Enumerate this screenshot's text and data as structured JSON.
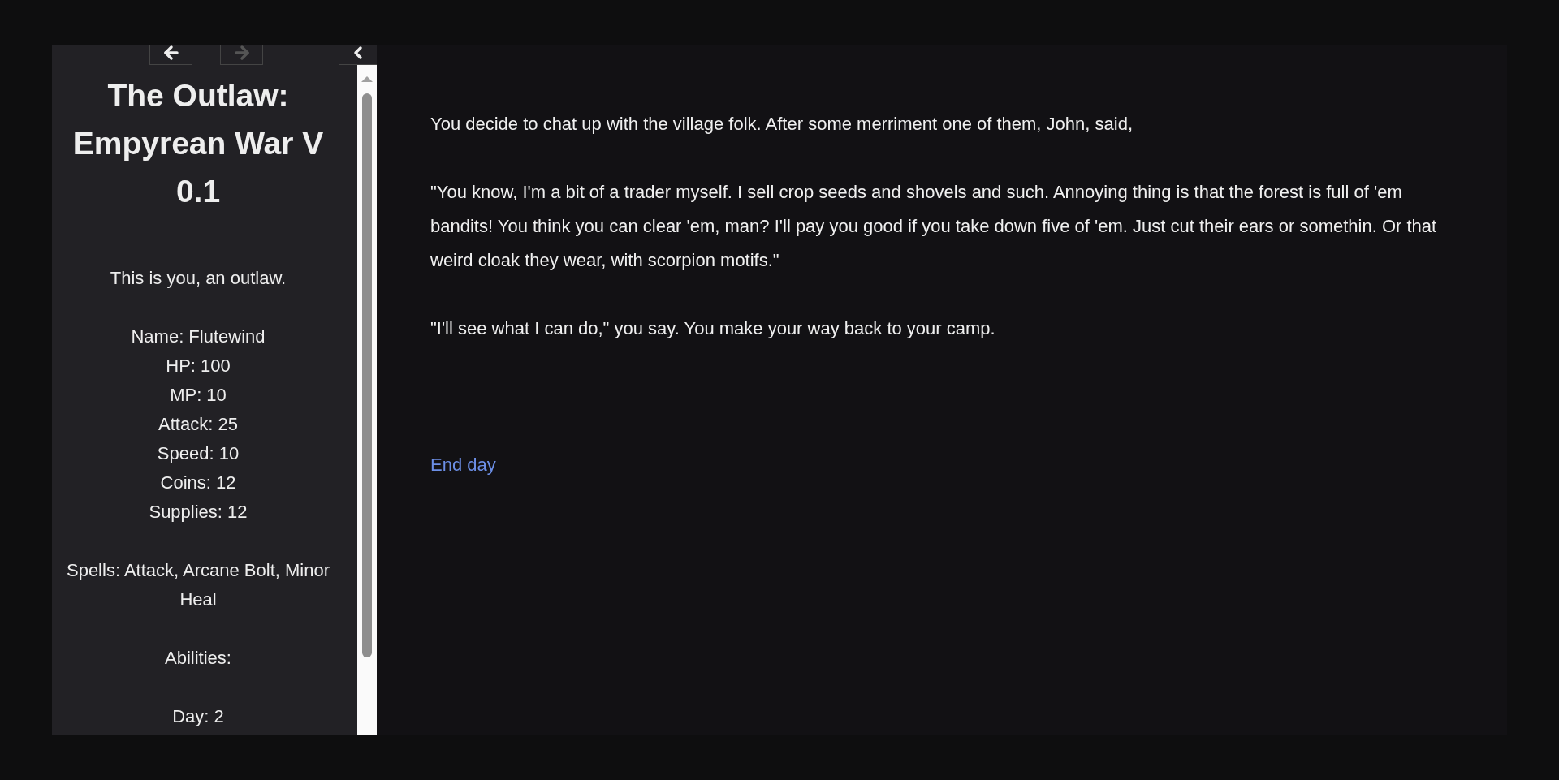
{
  "sidebar": {
    "history_buttons": [
      {
        "kind": "back",
        "disabled": false
      },
      {
        "kind": "forward",
        "disabled": true
      }
    ],
    "title": "The Outlaw: Empyrean War V 0.1",
    "caption_blocks": [
      [
        "This is you, an outlaw."
      ],
      [
        "Name: Flutewind",
        "HP: 100",
        "MP: 10",
        "Attack: 25",
        "Speed: 10",
        "Coins: 12",
        "Supplies: 12"
      ],
      [
        "Spells: Attack, Arcane Bolt, Minor Heal"
      ],
      [
        "Abilities:"
      ],
      [
        "Day: 2"
      ]
    ]
  },
  "passage": {
    "paragraphs": [
      "You decide to chat up with the village folk. After some merriment one of them, John, said,",
      "\"You know, I'm a bit of a trader myself. I sell crop seeds and shovels and such. Annoying thing is that the forest is full of 'em bandits! You think you can clear 'em, man? I'll pay you good if you take down five of 'em. Just cut their ears or somethin. Or that weird cloak they wear, with scorpion motifs.\"",
      "\"I'll see what I can do,\" you say. You make your way back to your camp."
    ],
    "link": "End day"
  }
}
